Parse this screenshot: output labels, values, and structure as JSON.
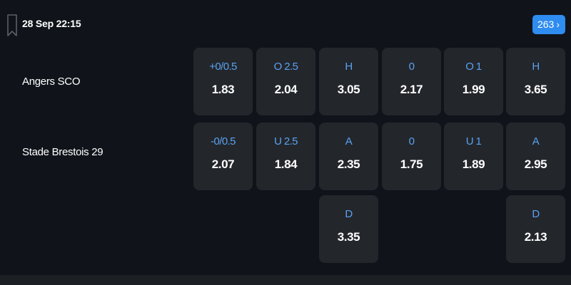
{
  "match": {
    "datetime": "28 Sep 22:15",
    "markets_count": "263",
    "home_team": "Angers SCO",
    "away_team": "Stade Brestois 29"
  },
  "odds": {
    "handicap_home": {
      "label": "+0/0.5",
      "value": "1.83"
    },
    "over_2_5": {
      "label": "O 2.5",
      "value": "2.04"
    },
    "fulltime_home": {
      "label": "H",
      "value": "3.05"
    },
    "halftime_handicap_home": {
      "label": "0",
      "value": "2.17"
    },
    "halftime_over_1": {
      "label": "O 1",
      "value": "1.99"
    },
    "halftime_home": {
      "label": "H",
      "value": "3.65"
    },
    "handicap_away": {
      "label": "-0/0.5",
      "value": "2.07"
    },
    "under_2_5": {
      "label": "U 2.5",
      "value": "1.84"
    },
    "fulltime_away": {
      "label": "A",
      "value": "2.35"
    },
    "halftime_handicap_away": {
      "label": "0",
      "value": "1.75"
    },
    "halftime_under_1": {
      "label": "U 1",
      "value": "1.89"
    },
    "halftime_away": {
      "label": "A",
      "value": "2.95"
    },
    "fulltime_draw": {
      "label": "D",
      "value": "3.35"
    },
    "halftime_draw": {
      "label": "D",
      "value": "2.13"
    }
  },
  "colors": {
    "background": "#10141a",
    "cell": "#23262b",
    "label_blue": "#5aa2f2",
    "badge_blue": "#2f8cf0"
  },
  "icons": {
    "bookmark": "bookmark-icon",
    "chevron": "chevron-right-icon"
  }
}
